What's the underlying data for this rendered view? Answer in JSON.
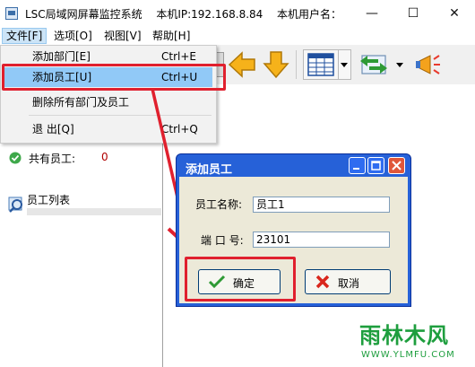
{
  "window": {
    "title": "LSC局域网屏幕监控系统",
    "ip_label": "本机IP:192.168.8.84",
    "user_label": "本机用户名：",
    "controls": {
      "minimize": "—",
      "maximize": "☐",
      "close": "✕"
    }
  },
  "menubar": {
    "file": "文件[F]",
    "options": "选项[O]",
    "view": "视图[V]",
    "help": "帮助[H]"
  },
  "file_menu": {
    "items": [
      {
        "label": "添加部门[E]",
        "shortcut": "Ctrl+E"
      },
      {
        "label": "添加员工[U]",
        "shortcut": "Ctrl+U"
      },
      {
        "label": "删除所有部门及员工",
        "shortcut": ""
      },
      {
        "label": "退 出[Q]",
        "shortcut": "Ctrl+Q"
      }
    ]
  },
  "sidebar": {
    "total_label": "共有员工:",
    "total_count": "0",
    "list_title": "员工列表"
  },
  "dialog": {
    "title": "添加员工",
    "name_label": "员工名称:",
    "name_value": "员工1",
    "port_label": "端 口 号:",
    "port_value": "23101",
    "ok_label": "确定",
    "cancel_label": "取消"
  },
  "watermark": {
    "brand": "雨林木风",
    "url": "WWW.YLMFU.COM"
  },
  "colors": {
    "highlight_red": "#e0202e",
    "menu_hover": "#91c9f7",
    "dialog_blue": "#2661d8"
  }
}
